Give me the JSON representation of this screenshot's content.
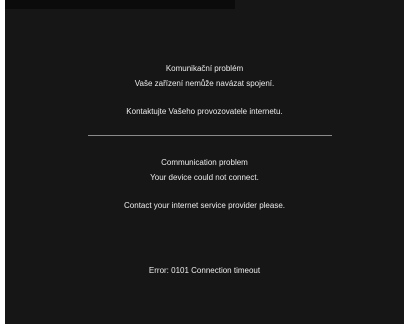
{
  "czech": {
    "title": "Komunikační problém",
    "subtitle": "Vaše zařízení nemůže navázat spojení.",
    "contact": "Kontaktujte Vašeho provozovatele internetu."
  },
  "english": {
    "title": "Communication problem",
    "subtitle": "Your device could not connect.",
    "contact": "Contact your internet service provider please."
  },
  "error": {
    "text": "Error: 0101 Connection timeout"
  }
}
